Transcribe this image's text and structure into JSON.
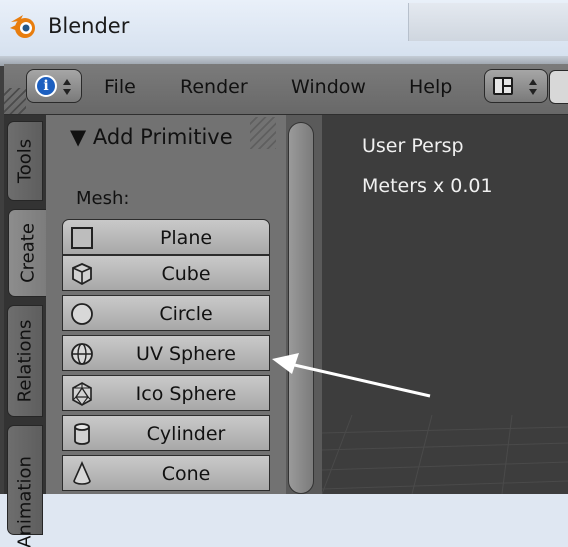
{
  "window": {
    "title": "Blender"
  },
  "header": {
    "menu": [
      {
        "key": "file",
        "label": "File"
      },
      {
        "key": "render",
        "label": "Render"
      },
      {
        "key": "window",
        "label": "Window"
      },
      {
        "key": "help",
        "label": "Help"
      }
    ]
  },
  "tabs": [
    {
      "key": "tools",
      "label": "Tools",
      "active": false
    },
    {
      "key": "create",
      "label": "Create",
      "active": true
    },
    {
      "key": "relations",
      "label": "Relations",
      "active": false
    },
    {
      "key": "animation",
      "label": "Animation",
      "active": false
    }
  ],
  "panel": {
    "title": "▼ Add Primitive",
    "mesh_label": "Mesh:",
    "primitives": [
      {
        "key": "plane",
        "label": "Plane",
        "icon": "plane-icon"
      },
      {
        "key": "cube",
        "label": "Cube",
        "icon": "cube-icon"
      },
      {
        "key": "circle",
        "label": "Circle",
        "icon": "circle-icon"
      },
      {
        "key": "uv-sphere",
        "label": "UV Sphere",
        "icon": "uv-sphere-icon"
      },
      {
        "key": "ico-sphere",
        "label": "Ico Sphere",
        "icon": "ico-sphere-icon"
      },
      {
        "key": "cylinder",
        "label": "Cylinder",
        "icon": "cylinder-icon"
      },
      {
        "key": "cone",
        "label": "Cone",
        "icon": "cone-icon"
      }
    ]
  },
  "viewport": {
    "view_name": "User Persp",
    "units": "Meters x 0.01"
  },
  "colors": {
    "info_icon": "#1c5fc0",
    "arrow": "#ffffff",
    "viewport_bg": "#3d3d3d"
  }
}
